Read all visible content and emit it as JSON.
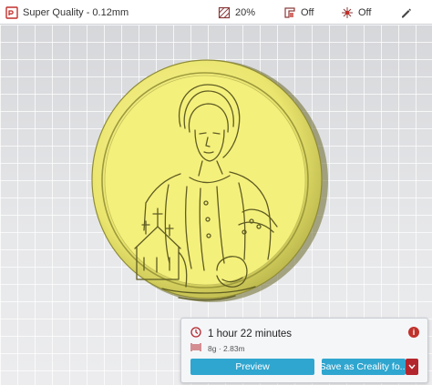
{
  "topbar": {
    "profile_label": "Super Quality - 0.12mm",
    "infill_value": "20%",
    "support_value": "Off",
    "adhesion_value": "Off",
    "icons": {
      "profile": "printer-profile-icon",
      "infill": "infill-icon",
      "support": "support-icon",
      "adhesion": "adhesion-icon",
      "edit": "pencil-icon"
    }
  },
  "print_panel": {
    "time_label": "1 hour 22 minutes",
    "material_label": "8g · 2.83m",
    "preview_label": "Preview",
    "save_label": "Save as Creality fo...",
    "icons": {
      "time": "clock-icon",
      "material": "filament-spool-icon",
      "info": "info-icon",
      "dropdown": "chevron-down-icon"
    }
  },
  "colors": {
    "accent": "#2fa6cf",
    "danger": "#b3262d",
    "model": "#f3ef7a",
    "model_edge": "#8f8c36"
  }
}
